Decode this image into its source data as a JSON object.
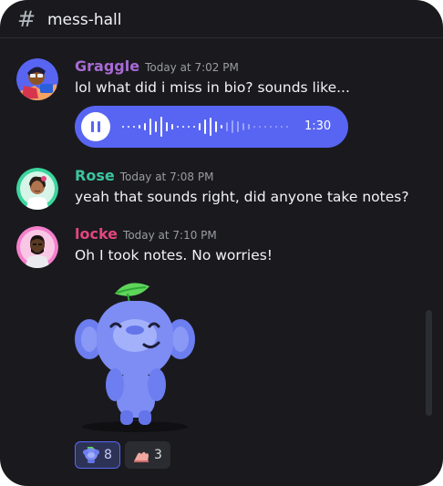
{
  "channel": {
    "name": "mess-hall",
    "hash_icon": "hash-icon"
  },
  "messages": [
    {
      "author": "Graggle",
      "author_color": "#a86ad4",
      "timestamp": "Today at 7:02 PM",
      "text": "lol what did i miss in bio? sounds like...",
      "voice": {
        "duration": "1:30",
        "button": "pause-icon",
        "accent": "#5865f2"
      }
    },
    {
      "author": "Rose",
      "author_color": "#3bc4a0",
      "timestamp": "Today at 7:08 PM",
      "text": "yeah that sounds right, did anyone take notes?"
    },
    {
      "author": "locke",
      "author_color": "#e2467c",
      "timestamp": "Today at 7:10 PM",
      "text": "Oh I took notes. No worries!",
      "sticker": "wumpus-sticker",
      "reactions": [
        {
          "emoji": "wumpus-emoji",
          "count": "8",
          "selected": true
        },
        {
          "emoji": "hand-emoji",
          "count": "3",
          "selected": false
        }
      ]
    }
  ]
}
